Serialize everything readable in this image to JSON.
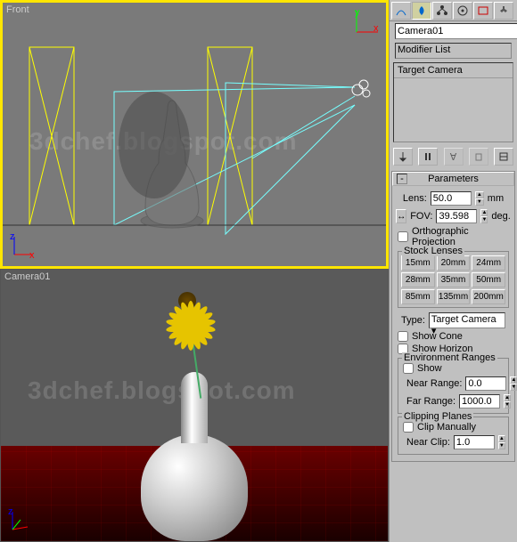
{
  "viewport": {
    "front_label": "Front",
    "camera_label": "Camera01"
  },
  "watermark": "3dchef.blogspot.com",
  "panel": {
    "object_name": "Camera01",
    "modifier_dropdown": "Modifier List",
    "stack_item": "Target Camera"
  },
  "parameters": {
    "header": "Parameters",
    "lens_label": "Lens:",
    "lens_value": "50.0",
    "lens_unit": "mm",
    "fov_label": "FOV:",
    "fov_value": "39.598",
    "fov_unit": "deg.",
    "ortho_label": "Orthographic Projection",
    "stock_title": "Stock Lenses",
    "lenses": [
      "15mm",
      "20mm",
      "24mm",
      "28mm",
      "35mm",
      "50mm",
      "85mm",
      "135mm",
      "200mm"
    ],
    "type_label": "Type:",
    "type_value": "Target Camera",
    "show_cone": "Show Cone",
    "show_horizon": "Show Horizon",
    "env_title": "Environment Ranges",
    "env_show": "Show",
    "near_label": "Near Range:",
    "near_value": "0.0",
    "far_label": "Far Range:",
    "far_value": "1000.0",
    "clip_title": "Clipping Planes",
    "clip_manual": "Clip Manually",
    "near_clip_label": "Near Clip:",
    "near_clip_value": "1.0"
  },
  "gizmo": {
    "x": "x",
    "y": "y",
    "z": "z"
  }
}
